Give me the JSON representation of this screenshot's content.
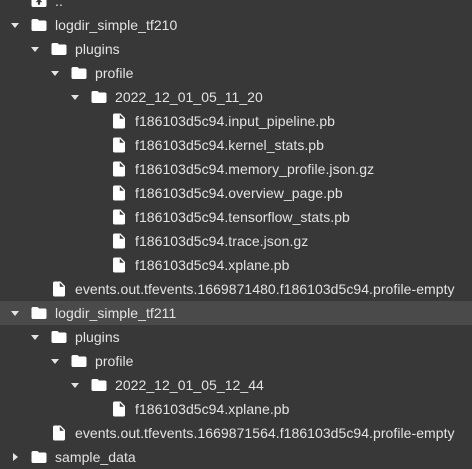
{
  "file_tree": {
    "rows": [
      {
        "name": "..",
        "type": "parent-folder",
        "depth": 1,
        "expanded": null,
        "selected": false
      },
      {
        "name": "logdir_simple_tf210",
        "type": "folder",
        "depth": 1,
        "expanded": true,
        "selected": false
      },
      {
        "name": "plugins",
        "type": "folder",
        "depth": 2,
        "expanded": true,
        "selected": false
      },
      {
        "name": "profile",
        "type": "folder",
        "depth": 3,
        "expanded": true,
        "selected": false
      },
      {
        "name": "2022_12_01_05_11_20",
        "type": "folder",
        "depth": 4,
        "expanded": true,
        "selected": false
      },
      {
        "name": "f186103d5c94.input_pipeline.pb",
        "type": "file",
        "depth": 5,
        "expanded": null,
        "selected": false
      },
      {
        "name": "f186103d5c94.kernel_stats.pb",
        "type": "file",
        "depth": 5,
        "expanded": null,
        "selected": false
      },
      {
        "name": "f186103d5c94.memory_profile.json.gz",
        "type": "file",
        "depth": 5,
        "expanded": null,
        "selected": false
      },
      {
        "name": "f186103d5c94.overview_page.pb",
        "type": "file",
        "depth": 5,
        "expanded": null,
        "selected": false
      },
      {
        "name": "f186103d5c94.tensorflow_stats.pb",
        "type": "file",
        "depth": 5,
        "expanded": null,
        "selected": false
      },
      {
        "name": "f186103d5c94.trace.json.gz",
        "type": "file",
        "depth": 5,
        "expanded": null,
        "selected": false
      },
      {
        "name": "f186103d5c94.xplane.pb",
        "type": "file",
        "depth": 5,
        "expanded": null,
        "selected": false
      },
      {
        "name": "events.out.tfevents.1669871480.f186103d5c94.profile-empty",
        "type": "file",
        "depth": 2,
        "expanded": null,
        "selected": false
      },
      {
        "name": "logdir_simple_tf211",
        "type": "folder",
        "depth": 1,
        "expanded": true,
        "selected": true
      },
      {
        "name": "plugins",
        "type": "folder",
        "depth": 2,
        "expanded": true,
        "selected": false
      },
      {
        "name": "profile",
        "type": "folder",
        "depth": 3,
        "expanded": true,
        "selected": false
      },
      {
        "name": "2022_12_01_05_12_44",
        "type": "folder",
        "depth": 4,
        "expanded": true,
        "selected": false
      },
      {
        "name": "f186103d5c94.xplane.pb",
        "type": "file",
        "depth": 5,
        "expanded": null,
        "selected": false
      },
      {
        "name": "events.out.tfevents.1669871564.f186103d5c94.profile-empty",
        "type": "file",
        "depth": 2,
        "expanded": null,
        "selected": false
      },
      {
        "name": "sample_data",
        "type": "folder",
        "depth": 1,
        "expanded": false,
        "selected": false
      }
    ]
  },
  "colors": {
    "background": "#383838",
    "selected_row": "#4a4a4a",
    "text": "#e3e3e3",
    "icon": "#ffffff",
    "chevron": "#e3e3e3"
  },
  "icons": {
    "parent-folder": "folder-up-icon",
    "folder": "folder-icon",
    "file": "file-icon",
    "expanded": "chevron-down-icon",
    "collapsed": "chevron-right-icon"
  }
}
